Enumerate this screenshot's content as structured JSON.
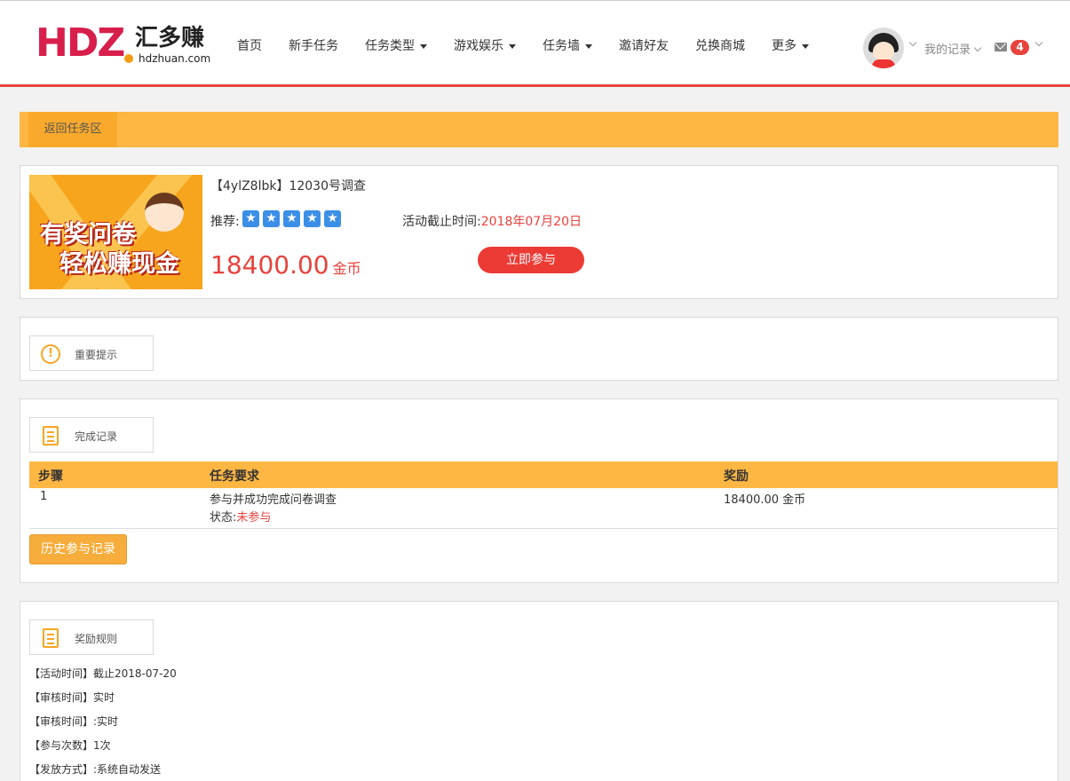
{
  "logo": {
    "mark": "HDZ",
    "cn": "汇多赚",
    "domain": "hdzhuan.com"
  },
  "nav": [
    {
      "label": "首页",
      "dropdown": false
    },
    {
      "label": "新手任务",
      "dropdown": false
    },
    {
      "label": "任务类型",
      "dropdown": true
    },
    {
      "label": "游戏娱乐",
      "dropdown": true
    },
    {
      "label": "任务墙",
      "dropdown": true
    },
    {
      "label": "邀请好友",
      "dropdown": false
    },
    {
      "label": "兑换商城",
      "dropdown": false
    },
    {
      "label": "更多",
      "dropdown": true
    }
  ],
  "user": {
    "records_label": "我的记录",
    "message_count": "4"
  },
  "back": {
    "label": "返回任务区"
  },
  "task": {
    "banner_line1": "有奖问卷",
    "banner_line2": "轻松赚现金",
    "title": "【4ylZ8lbk】12030号调查",
    "recommend_label": "推荐:",
    "stars": 5,
    "deadline_label": "活动截止时间:",
    "deadline": "2018年07月20日",
    "price": "18400.00",
    "unit": "金币",
    "join_label": "立即参与"
  },
  "notice": {
    "title": "重要提示"
  },
  "records": {
    "title": "完成记录",
    "columns": [
      "步骤",
      "任务要求",
      "奖励"
    ],
    "row": {
      "step": "1",
      "requirement": "参与并成功完成问卷调查",
      "status_label": "状态:",
      "status": "未参与",
      "reward": "18400.00 金币"
    },
    "history_label": "历史参与记录"
  },
  "rules": {
    "title": "奖励规则",
    "lines": [
      "【活动时间】截止2018-07-20",
      "【审核时间】实时",
      "【审核时间】:实时",
      "【参与次数】1次",
      "【发放方式】:系统自动发送"
    ]
  },
  "colors": {
    "accent": "#ffb744",
    "red": "#e8423c",
    "header_border": "#e9453b",
    "star": "#3b8fe6"
  }
}
